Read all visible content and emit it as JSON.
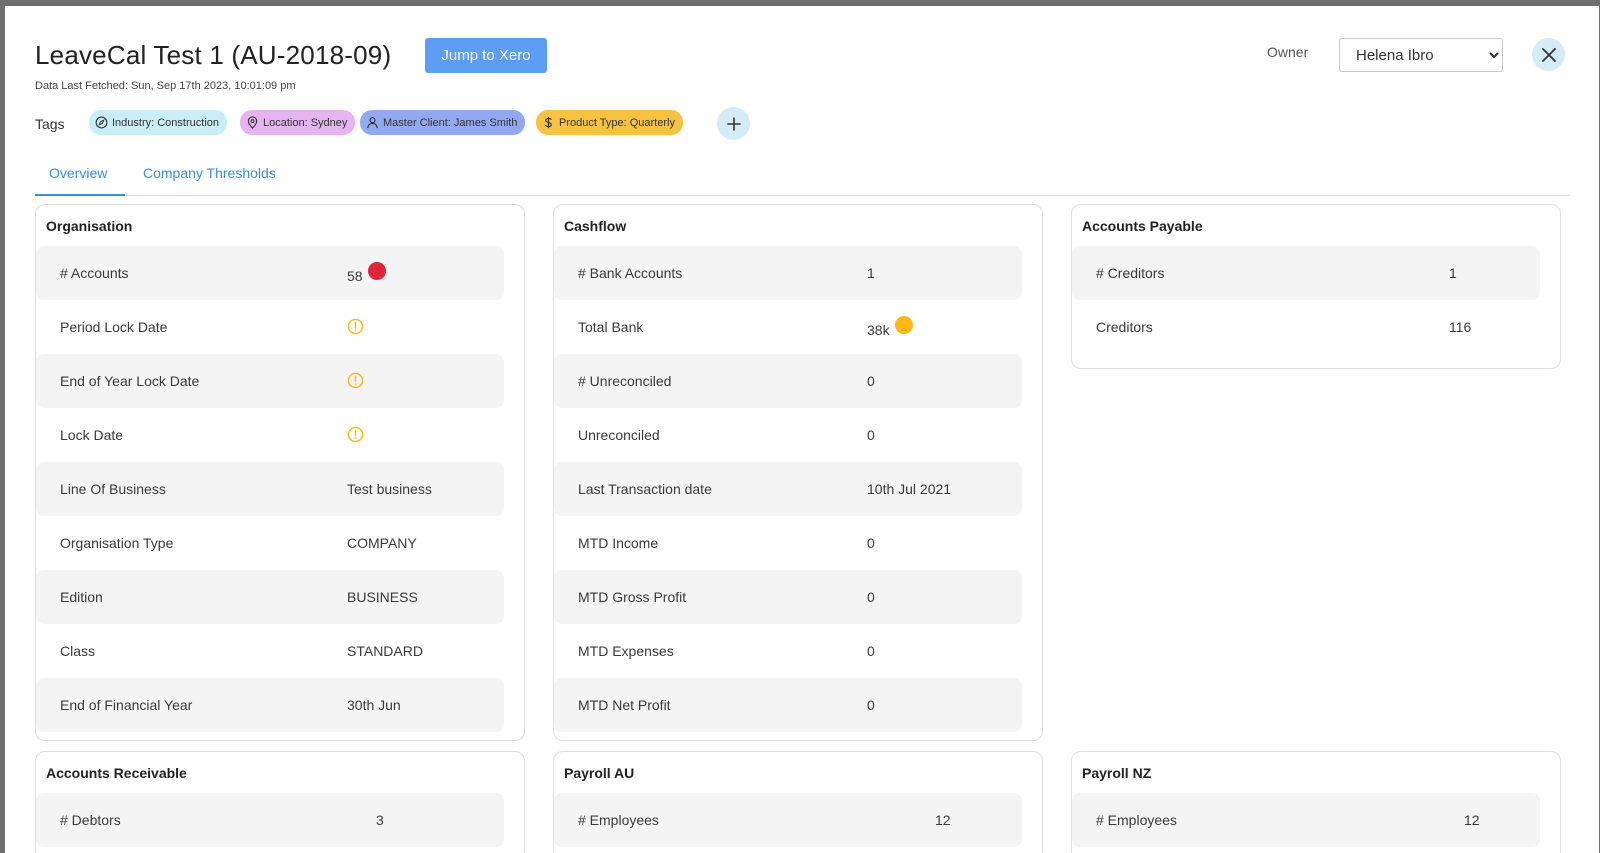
{
  "header": {
    "title": "LeaveCal Test 1 (AU-2018-09)",
    "jump_button": "Jump to Xero",
    "fetched": "Data Last Fetched: Sun, Sep 17th 2023, 10:01:09 pm",
    "owner_label": "Owner",
    "owner_value": "Helena Ibro"
  },
  "tags": {
    "label": "Tags",
    "items": [
      {
        "text": "Industry: Construction",
        "icon": "compass-icon",
        "color": "#c8eef7"
      },
      {
        "text": "Location: Sydney",
        "icon": "location-pin-icon",
        "color": "#e5b4f1"
      },
      {
        "text": "Master Client: James Smith",
        "icon": "user-icon",
        "color": "#92a9f1"
      },
      {
        "text": "Product Type: Quarterly",
        "icon": "dollar-icon",
        "color": "#f6c242"
      }
    ]
  },
  "tabs": [
    {
      "label": "Overview",
      "active": true
    },
    {
      "label": "Company Thresholds",
      "active": false
    }
  ],
  "colors": {
    "accent": "#5c9ef3",
    "status_red": "#e3233a",
    "status_yellow": "#fdb813",
    "row_shade": "#f5f4f5"
  },
  "cards": {
    "organisation": {
      "title": "Organisation",
      "rows": [
        {
          "label": "# Accounts",
          "value": "58",
          "status": "red-dot"
        },
        {
          "label": "Period Lock Date",
          "value": "",
          "status": "warning-icon"
        },
        {
          "label": "End of Year Lock Date",
          "value": "",
          "status": "warning-icon"
        },
        {
          "label": "Lock Date",
          "value": "",
          "status": "warning-icon"
        },
        {
          "label": "Line Of Business",
          "value": "Test business"
        },
        {
          "label": "Organisation Type",
          "value": "COMPANY"
        },
        {
          "label": "Edition",
          "value": "BUSINESS"
        },
        {
          "label": "Class",
          "value": "STANDARD"
        },
        {
          "label": "End of Financial Year",
          "value": "30th Jun"
        }
      ]
    },
    "cashflow": {
      "title": "Cashflow",
      "rows": [
        {
          "label": "# Bank Accounts",
          "value": "1"
        },
        {
          "label": "Total Bank",
          "value": "38k",
          "status": "yellow-dot"
        },
        {
          "label": "# Unreconciled",
          "value": "0"
        },
        {
          "label": "Unreconciled",
          "value": "0"
        },
        {
          "label": "Last Transaction date",
          "value": "10th Jul 2021"
        },
        {
          "label": "MTD Income",
          "value": "0"
        },
        {
          "label": "MTD Gross Profit",
          "value": "0"
        },
        {
          "label": "MTD Expenses",
          "value": "0"
        },
        {
          "label": "MTD Net Profit",
          "value": "0"
        }
      ]
    },
    "payable": {
      "title": "Accounts Payable",
      "rows": [
        {
          "label": "# Creditors",
          "value": "1"
        },
        {
          "label": "Creditors",
          "value": "116"
        }
      ]
    },
    "receivable": {
      "title": "Accounts Receivable",
      "rows": [
        {
          "label": "# Debtors",
          "value": "3"
        }
      ]
    },
    "payroll_au": {
      "title": "Payroll AU",
      "rows": [
        {
          "label": "# Employees",
          "value": "12"
        }
      ]
    },
    "payroll_nz": {
      "title": "Payroll NZ",
      "rows": [
        {
          "label": "# Employees",
          "value": "12"
        }
      ]
    }
  }
}
